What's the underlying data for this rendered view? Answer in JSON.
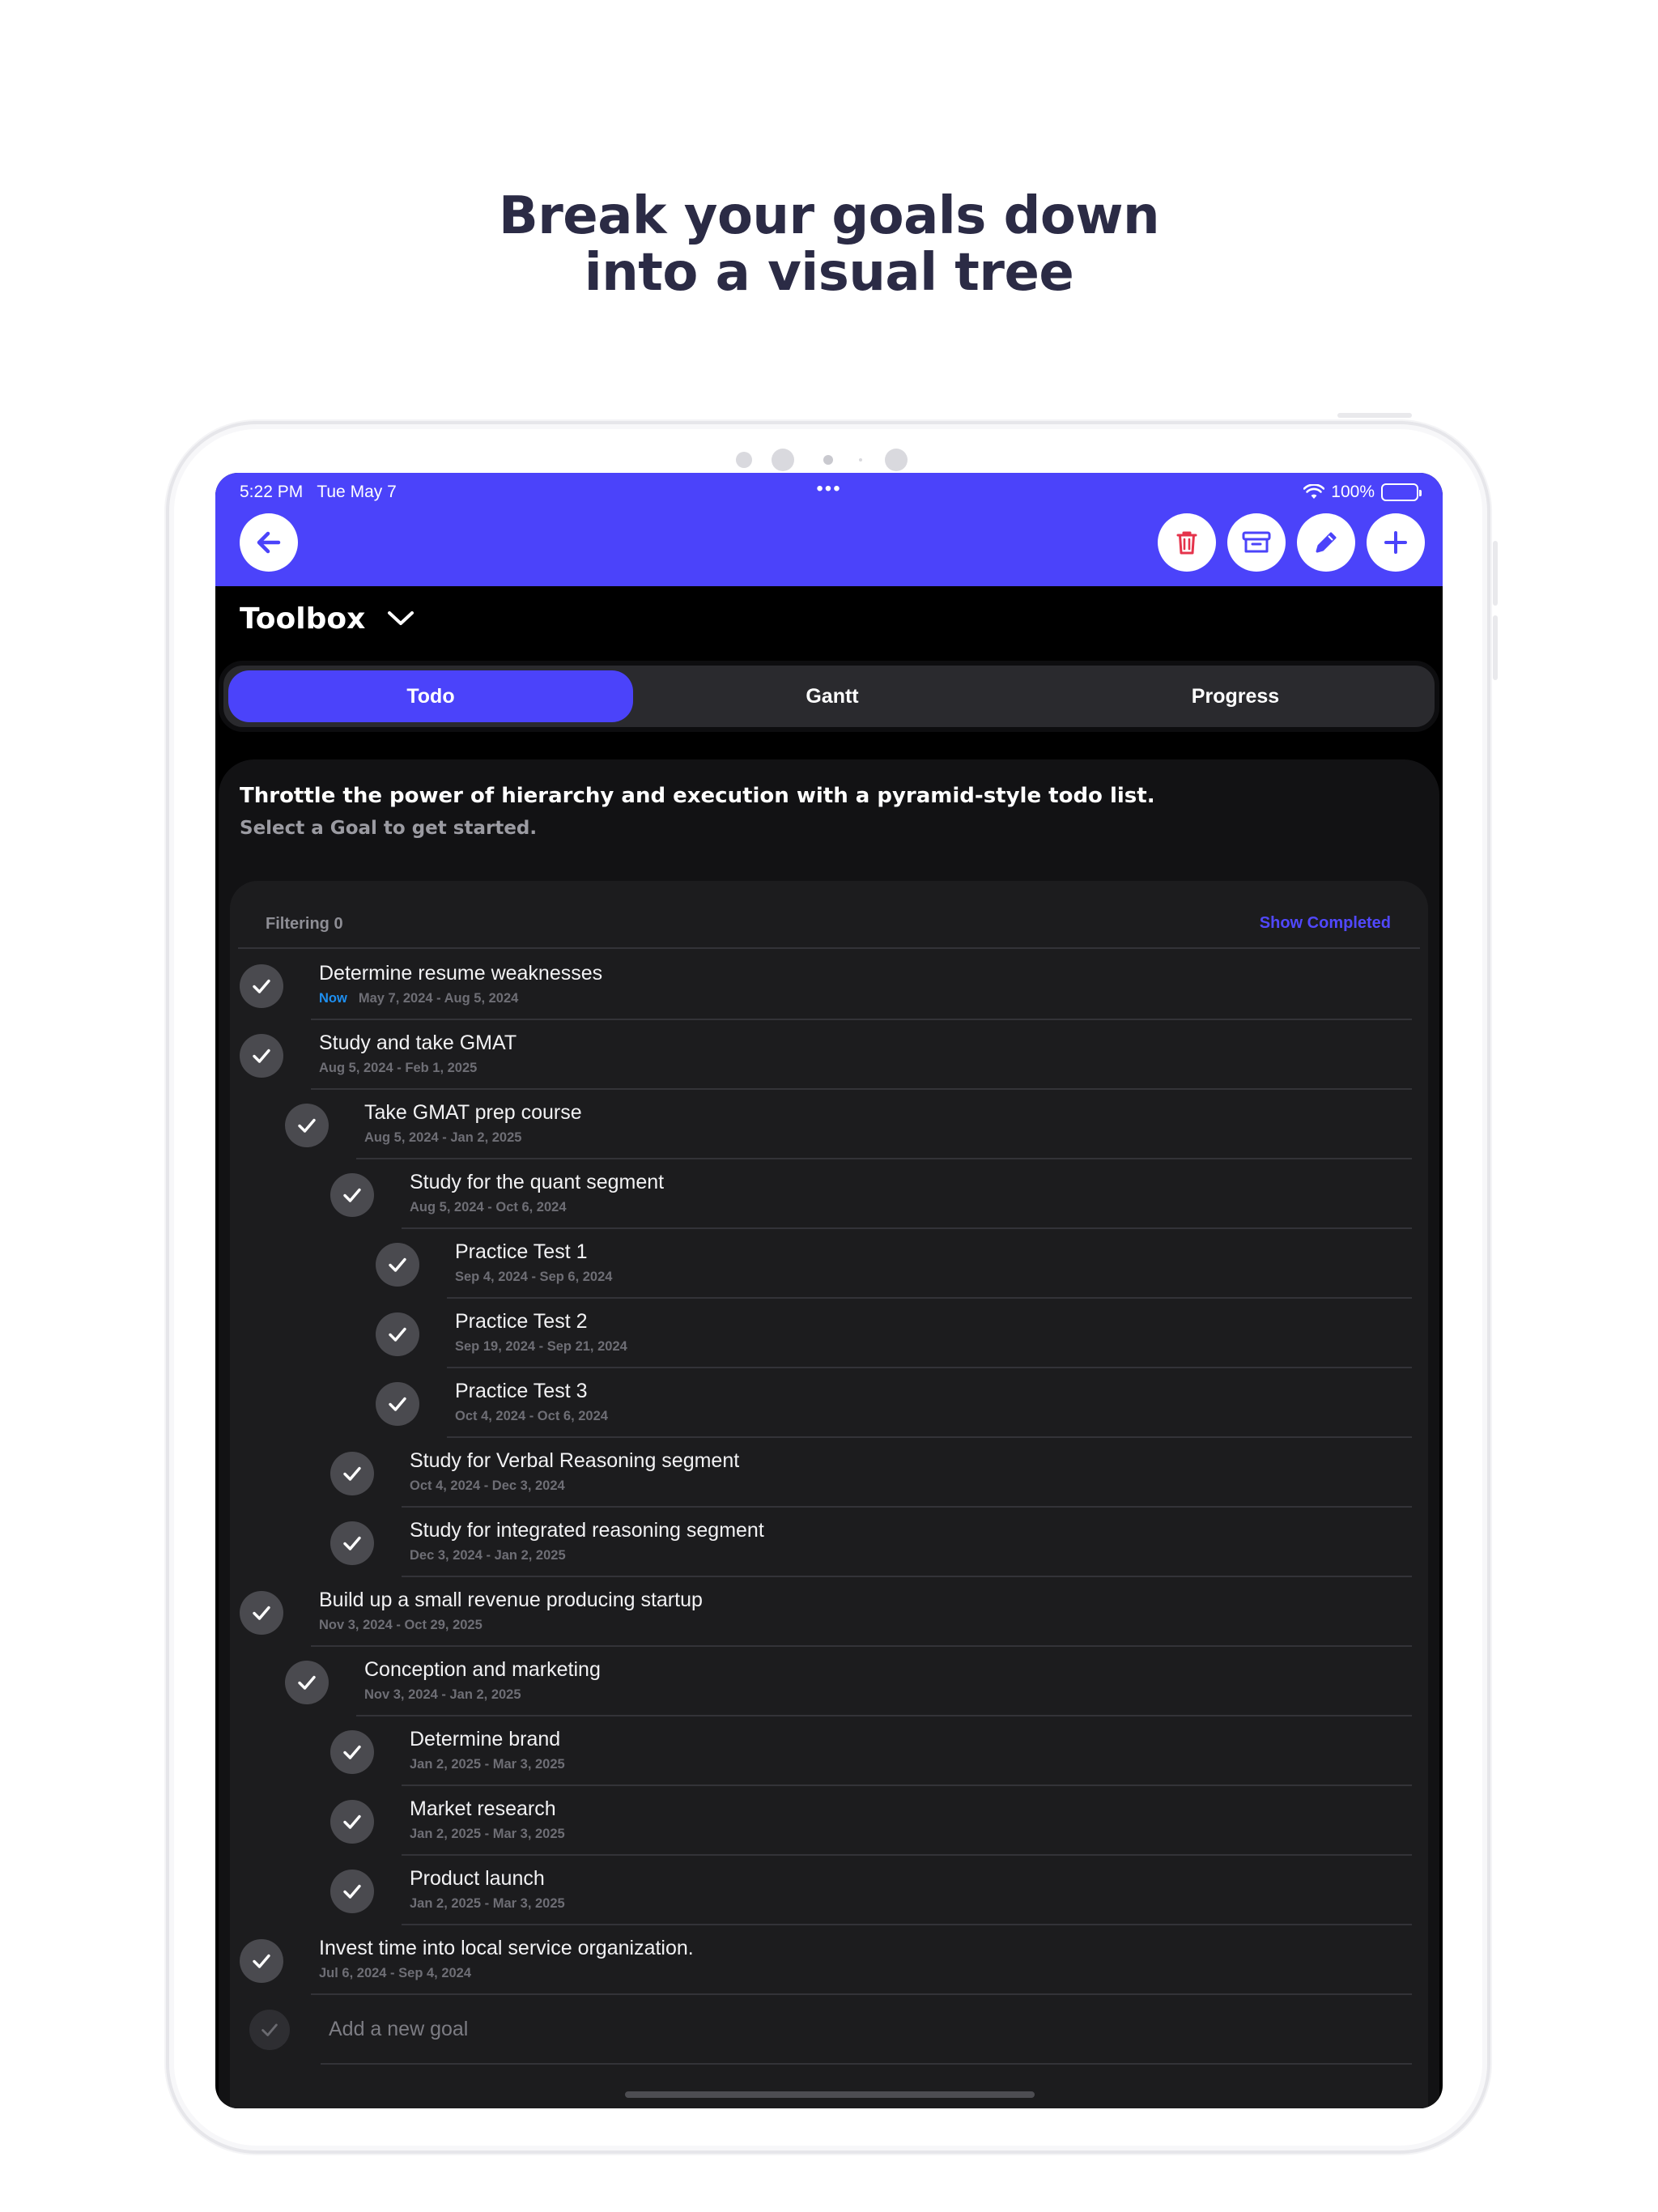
{
  "headline": {
    "line1": "Break your goals down",
    "line2": "into a visual tree"
  },
  "status_bar": {
    "time": "5:22 PM   Tue May 7",
    "dots": "•••",
    "battery": "100%"
  },
  "header": {
    "back_icon": "arrow-left-icon",
    "actions": [
      {
        "icon": "trash-icon",
        "color": "#e5334b"
      },
      {
        "icon": "archive-icon",
        "color": "#4b43fa"
      },
      {
        "icon": "pencil-icon",
        "color": "#4b43fa"
      },
      {
        "icon": "plus-icon",
        "color": "#4b43fa"
      }
    ],
    "color": "#4b43fa"
  },
  "toolbox": {
    "title": "Toolbox"
  },
  "tabs": [
    {
      "label": "Todo",
      "active": true
    },
    {
      "label": "Gantt",
      "active": false
    },
    {
      "label": "Progress",
      "active": false
    }
  ],
  "intro": {
    "title": "Throttle the power of hierarchy and execution with a pyramid-style todo list.",
    "subtitle": "Select a Goal to get started."
  },
  "filter": {
    "label": "Filtering 0",
    "show_completed": "Show Completed"
  },
  "goals": [
    {
      "title": "Determine resume weaknesses",
      "dates": "May 7, 2024 - Aug 5, 2024",
      "badge": "Now",
      "level": 0
    },
    {
      "title": "Study and take GMAT",
      "dates": "Aug 5, 2024 - Feb 1, 2025",
      "level": 0
    },
    {
      "title": "Take GMAT prep course",
      "dates": "Aug 5, 2024 - Jan 2, 2025",
      "level": 1
    },
    {
      "title": "Study for the quant segment",
      "dates": "Aug 5, 2024 - Oct 6, 2024",
      "level": 2
    },
    {
      "title": "Practice Test 1",
      "dates": "Sep 4, 2024 - Sep 6, 2024",
      "level": 3
    },
    {
      "title": "Practice Test 2",
      "dates": "Sep 19, 2024 - Sep 21, 2024",
      "level": 3
    },
    {
      "title": "Practice Test 3",
      "dates": "Oct 4, 2024 - Oct 6, 2024",
      "level": 3
    },
    {
      "title": "Study for Verbal Reasoning segment",
      "dates": "Oct 4, 2024 - Dec 3, 2024",
      "level": 2
    },
    {
      "title": "Study for integrated reasoning segment",
      "dates": "Dec 3, 2024 - Jan 2, 2025",
      "level": 2
    },
    {
      "title": "Build up a small revenue producing startup",
      "dates": "Nov 3, 2024 - Oct 29, 2025",
      "level": 0
    },
    {
      "title": "Conception and marketing",
      "dates": "Nov 3, 2024 - Jan 2, 2025",
      "level": 1
    },
    {
      "title": "Determine brand",
      "dates": "Jan 2, 2025 - Mar 3, 2025",
      "level": 2
    },
    {
      "title": "Market research",
      "dates": "Jan 2, 2025 - Mar 3, 2025",
      "level": 2
    },
    {
      "title": "Product launch",
      "dates": "Jan 2, 2025 - Mar 3, 2025",
      "level": 2
    },
    {
      "title": "Invest time into local service organization.",
      "dates": "Jul 6, 2024 - Sep 4, 2024",
      "level": 0
    }
  ],
  "add_goal": {
    "placeholder": "Add a new goal"
  }
}
